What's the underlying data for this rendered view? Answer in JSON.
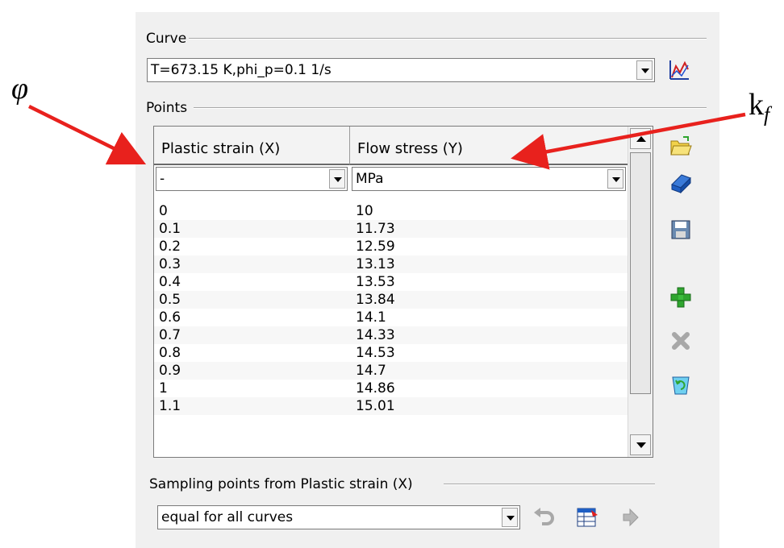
{
  "annotations": {
    "left_symbol": "φ",
    "right_symbol": "k",
    "right_subscript": "f"
  },
  "curve": {
    "group_label": "Curve",
    "selected": "T=673.15 K,phi_p=0.1 1/s",
    "icon": "curve-chart-icon"
  },
  "points": {
    "group_label": "Points",
    "columns": [
      {
        "header": "Plastic strain (X)",
        "unit": "-"
      },
      {
        "header": "Flow stress (Y)",
        "unit": "MPa"
      }
    ],
    "rows": [
      [
        "0",
        "10"
      ],
      [
        "0.1",
        "11.73"
      ],
      [
        "0.2",
        "12.59"
      ],
      [
        "0.3",
        "13.13"
      ],
      [
        "0.4",
        "13.53"
      ],
      [
        "0.5",
        "13.84"
      ],
      [
        "0.6",
        "14.1"
      ],
      [
        "0.7",
        "14.33"
      ],
      [
        "0.8",
        "14.53"
      ],
      [
        "0.9",
        "14.7"
      ],
      [
        "1",
        "14.86"
      ],
      [
        "1.1",
        "15.01"
      ]
    ],
    "side_icons": [
      "open-folder-icon",
      "eraser-icon",
      "save-disk-icon",
      "add-plus-icon",
      "delete-x-icon",
      "recycle-bin-icon"
    ]
  },
  "sampling": {
    "group_label": "Sampling points from Plastic strain (X)",
    "selected": "equal for all curves",
    "icons": [
      "undo-icon",
      "table-edit-icon",
      "apply-arrow-icon"
    ]
  },
  "colors": {
    "arrow": "#e8211d",
    "panel": "#f0f0f0",
    "icon_blue": "#1f5fc4",
    "icon_green": "#2fa52f"
  }
}
